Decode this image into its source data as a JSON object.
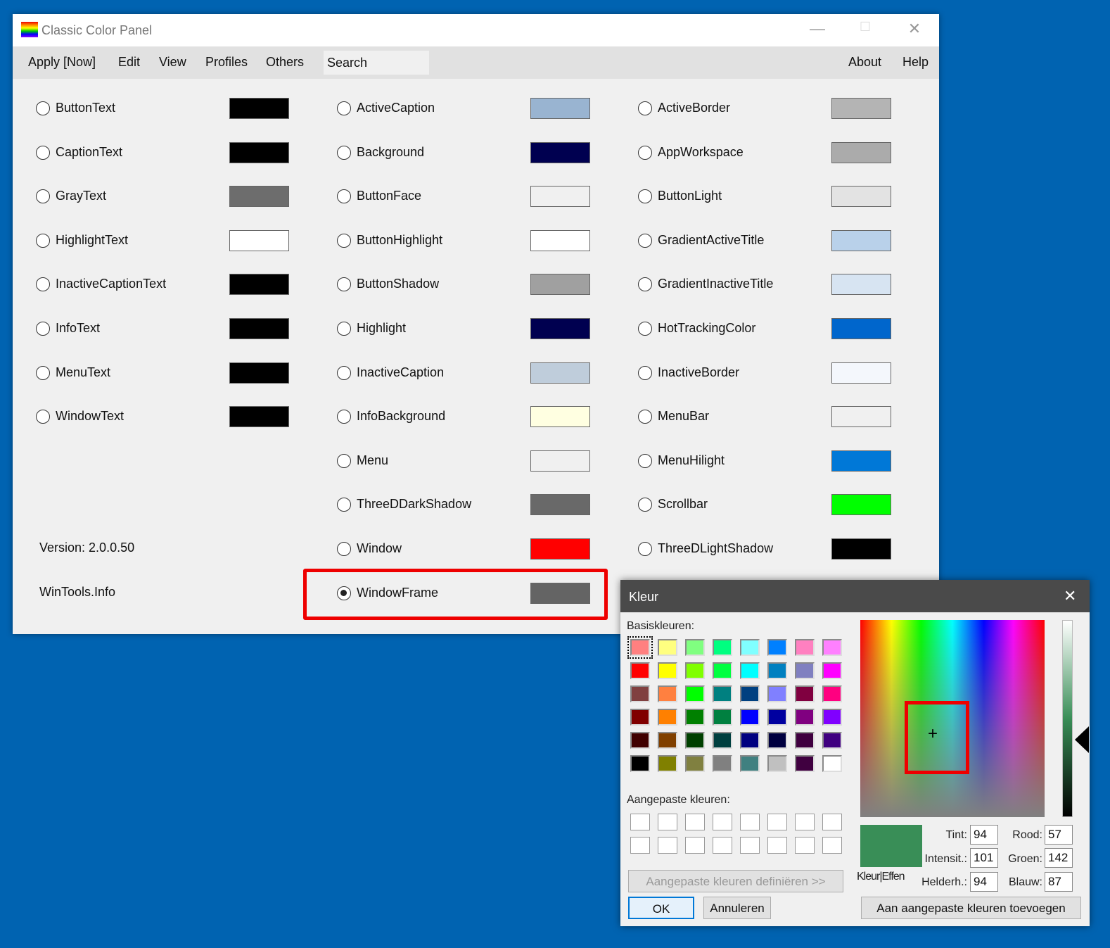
{
  "window": {
    "title": "Classic Color Panel",
    "menu": [
      "Apply [Now]",
      "Edit",
      "View",
      "Profiles",
      "Others"
    ],
    "search": "Search",
    "right_menu": [
      "About",
      "Help"
    ],
    "version": "Version: 2.0.0.50",
    "website": "WinTools.Info"
  },
  "columns": [
    [
      {
        "label": "ButtonText",
        "color": "#000000"
      },
      {
        "label": "CaptionText",
        "color": "#000000"
      },
      {
        "label": "GrayText",
        "color": "#6d6d6d"
      },
      {
        "label": "HighlightText",
        "color": "#ffffff"
      },
      {
        "label": "InactiveCaptionText",
        "color": "#000000"
      },
      {
        "label": "InfoText",
        "color": "#000000"
      },
      {
        "label": "MenuText",
        "color": "#000000"
      },
      {
        "label": "WindowText",
        "color": "#000000"
      }
    ],
    [
      {
        "label": "ActiveCaption",
        "color": "#99b4d1"
      },
      {
        "label": "Background",
        "color": "#000050"
      },
      {
        "label": "ButtonFace",
        "color": "#f0f0f0"
      },
      {
        "label": "ButtonHighlight",
        "color": "#ffffff"
      },
      {
        "label": "ButtonShadow",
        "color": "#a0a0a0"
      },
      {
        "label": "Highlight",
        "color": "#000050"
      },
      {
        "label": "InactiveCaption",
        "color": "#bfcddb"
      },
      {
        "label": "InfoBackground",
        "color": "#ffffe1"
      },
      {
        "label": "Menu",
        "color": "#f0f0f0"
      },
      {
        "label": "ThreeDDarkShadow",
        "color": "#696969"
      },
      {
        "label": "Window",
        "color": "#ff0000"
      },
      {
        "label": "WindowFrame",
        "color": "#646464",
        "selected": true
      }
    ],
    [
      {
        "label": "ActiveBorder",
        "color": "#b4b4b4"
      },
      {
        "label": "AppWorkspace",
        "color": "#ababab"
      },
      {
        "label": "ButtonLight",
        "color": "#e3e3e3"
      },
      {
        "label": "GradientActiveTitle",
        "color": "#b9d1ea"
      },
      {
        "label": "GradientInactiveTitle",
        "color": "#d7e4f2"
      },
      {
        "label": "HotTrackingColor",
        "color": "#0066cc"
      },
      {
        "label": "InactiveBorder",
        "color": "#f4f7fc"
      },
      {
        "label": "MenuBar",
        "color": "#f0f0f0"
      },
      {
        "label": "MenuHilight",
        "color": "#0078d7"
      },
      {
        "label": "Scrollbar",
        "color": "#00ff00"
      },
      {
        "label": "ThreeDLightShadow",
        "color": "#000000"
      }
    ]
  ],
  "dialog": {
    "title": "Kleur",
    "basic_label": "Basiskleuren:",
    "custom_label": "Aangepaste kleuren:",
    "basic_colors": [
      "#ff8080",
      "#ffff80",
      "#80ff80",
      "#00ff80",
      "#80ffff",
      "#0080ff",
      "#ff80c0",
      "#ff80ff",
      "#ff0000",
      "#ffff00",
      "#80ff00",
      "#00ff40",
      "#00ffff",
      "#0080c0",
      "#8080c0",
      "#ff00ff",
      "#804040",
      "#ff8040",
      "#00ff00",
      "#008080",
      "#004080",
      "#8080ff",
      "#800040",
      "#ff0080",
      "#800000",
      "#ff8000",
      "#008000",
      "#008040",
      "#0000ff",
      "#0000a0",
      "#800080",
      "#8000ff",
      "#400000",
      "#804000",
      "#004000",
      "#004040",
      "#000080",
      "#000040",
      "#400040",
      "#400080",
      "#000000",
      "#808000",
      "#808040",
      "#808080",
      "#408080",
      "#c0c0c0",
      "#400040",
      "#ffffff"
    ],
    "define_custom": "Aangepaste kleuren definiëren >>",
    "ok": "OK",
    "cancel": "Annuleren",
    "add_custom": "Aan aangepaste kleuren toevoegen",
    "preview_label": "Kleur|Effen",
    "preview_color": "#398e57",
    "fields": {
      "tint_label": "Tint:",
      "tint": "94",
      "sat_label": "Intensit.:",
      "sat": "101",
      "lum_label": "Helderh.:",
      "lum": "94",
      "red_label": "Rood:",
      "red": "57",
      "green_label": "Groen:",
      "green": "142",
      "blue_label": "Blauw:",
      "blue": "87"
    }
  }
}
